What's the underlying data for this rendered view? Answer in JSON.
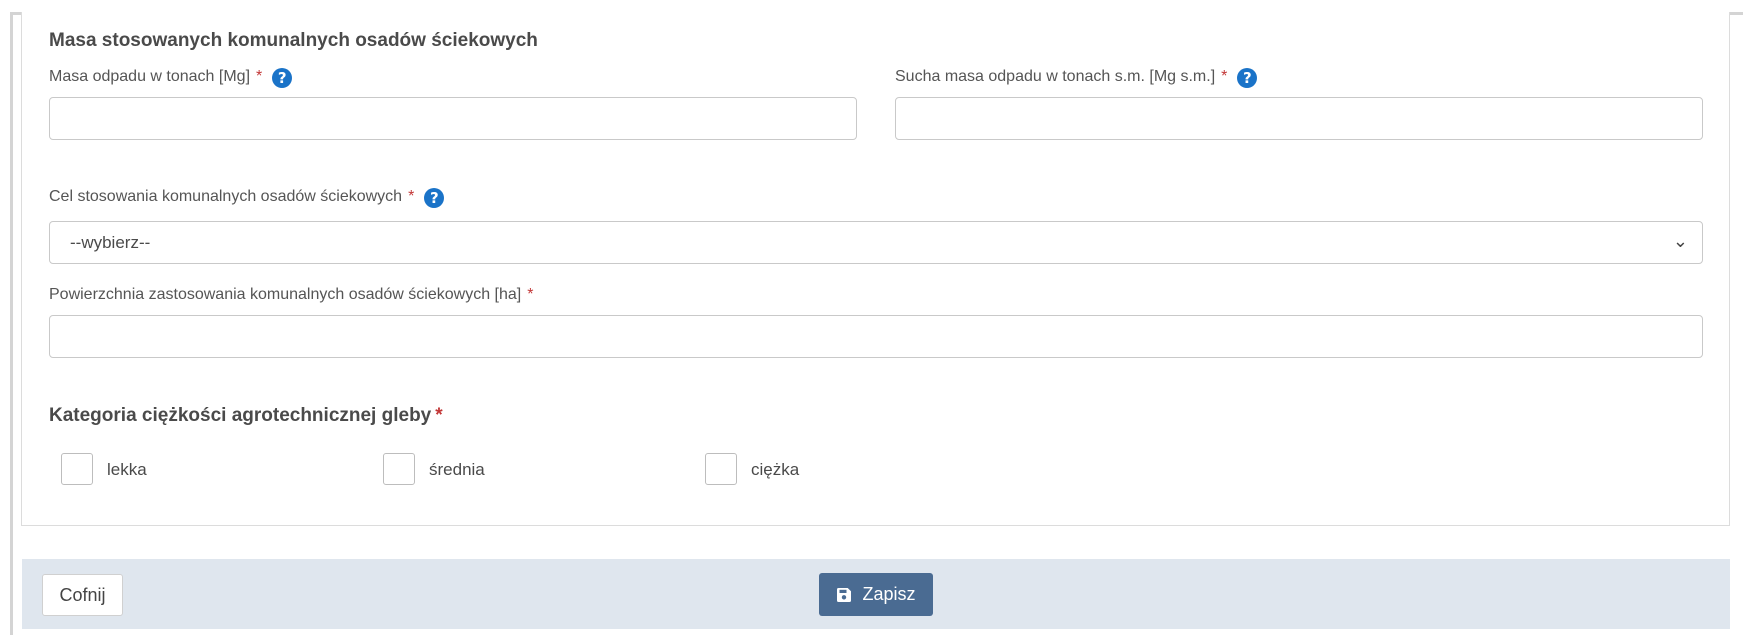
{
  "section": {
    "title": "Masa stosowanych komunalnych osadów ściekowych"
  },
  "fields": {
    "mass": {
      "label": "Masa odpadu w tonach [Mg]",
      "required": "*",
      "value": ""
    },
    "dry_mass": {
      "label": "Sucha masa odpadu w tonach s.m. [Mg s.m.]",
      "required": "*",
      "value": ""
    },
    "purpose": {
      "label": "Cel stosowania komunalnych osadów ściekowych",
      "required": "*",
      "selected": "--wybierz--"
    },
    "area": {
      "label": "Powierzchnia zastosowania komunalnych osadów ściekowych [ha]",
      "required": "*",
      "value": ""
    }
  },
  "help_glyph": "?",
  "soil": {
    "title": "Kategoria ciężkości agrotechnicznej gleby",
    "required": "*",
    "options": [
      {
        "label": "lekka",
        "checked": false
      },
      {
        "label": "średnia",
        "checked": false
      },
      {
        "label": "ciężka",
        "checked": false
      }
    ]
  },
  "footer": {
    "back_label": "Cofnij",
    "save_label": "Zapisz"
  },
  "colors": {
    "help_icon": "#1a73c8",
    "required": "#c23636",
    "save_button": "#4a6b92",
    "footer_bg": "#dfe6ee"
  },
  "icons": {
    "help": "question-circle-icon",
    "select": "chevron-down-icon",
    "save": "floppy-disk-icon"
  }
}
